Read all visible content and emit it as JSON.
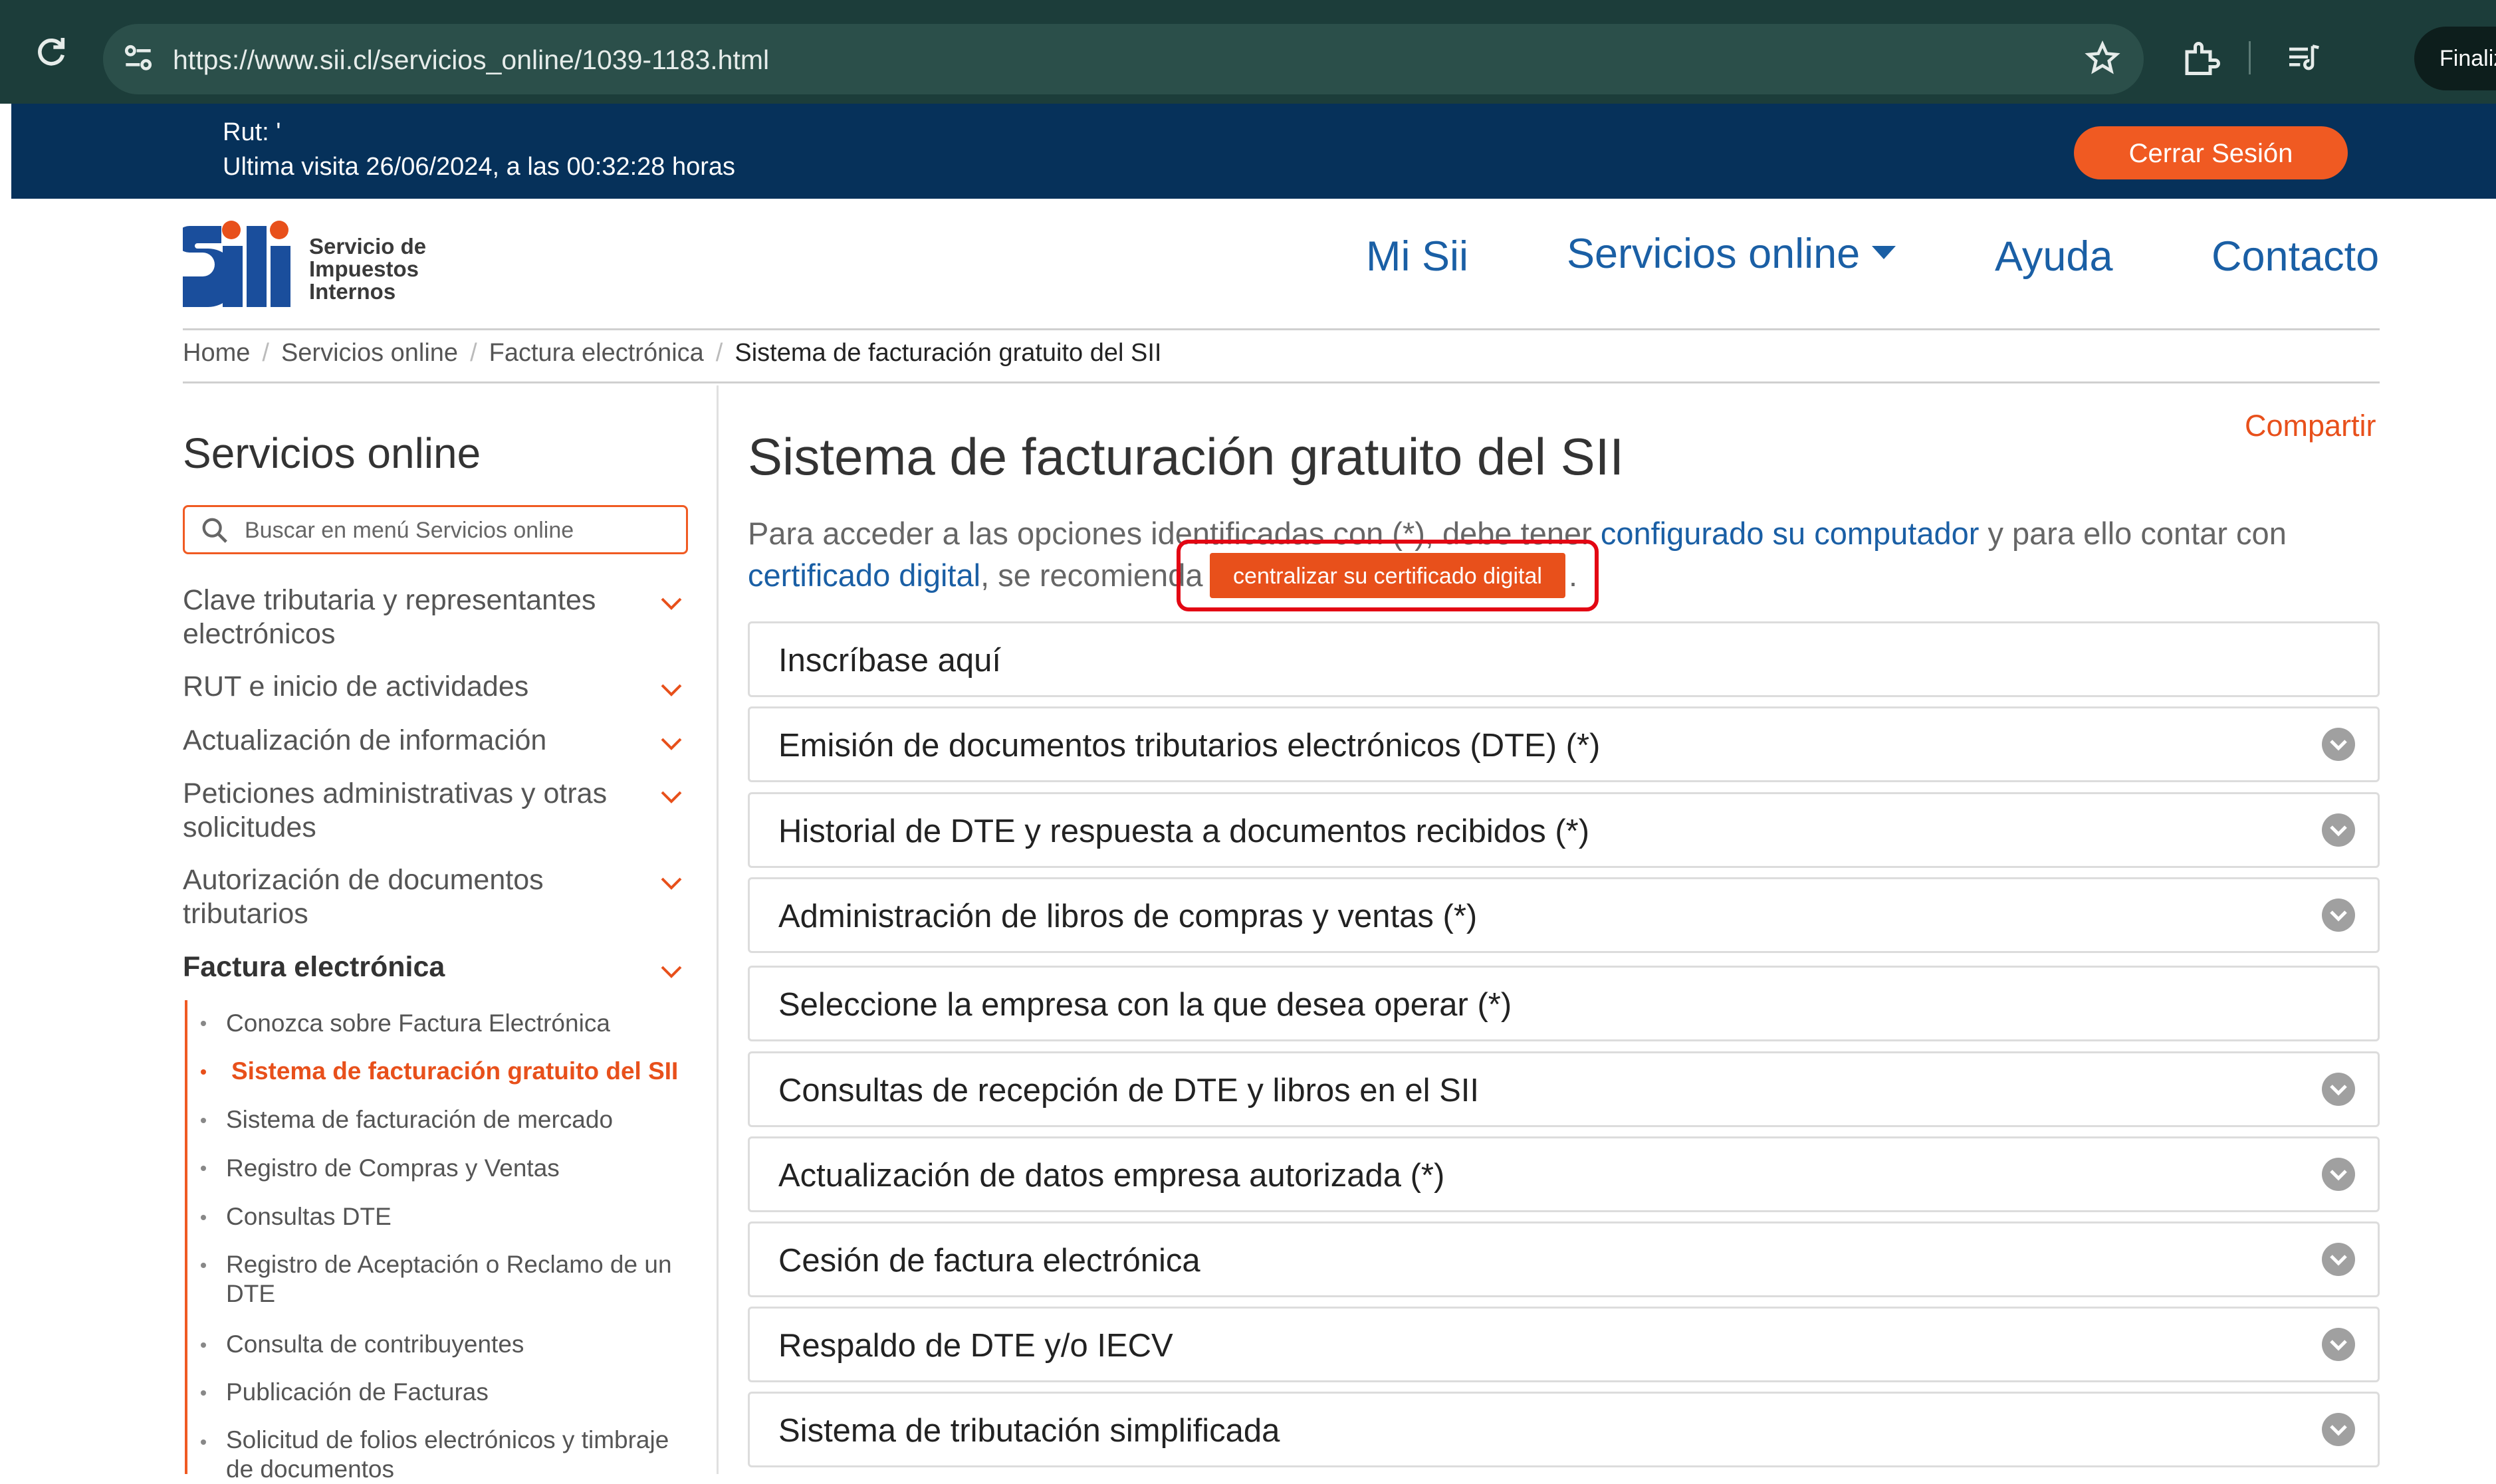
{
  "browser": {
    "url": "https://www.sii.cl/servicios_online/1039-1183.html",
    "profile_label": "Finaliz"
  },
  "session": {
    "rut_label": "Rut: '",
    "last_visit": "Ultima visita 26/06/2024, a las 00:32:28 horas",
    "logout_label": "Cerrar Sesión"
  },
  "logo": {
    "line1": "Servicio de",
    "line2": "Impuestos",
    "line3": "Internos"
  },
  "nav": {
    "items": [
      "Mi Sii",
      "Servicios online",
      "Ayuda",
      "Contacto"
    ]
  },
  "breadcrumb": [
    "Home",
    "Servicios online",
    "Factura electrónica",
    "Sistema de facturación gratuito del SII"
  ],
  "sidebar": {
    "title": "Servicios online",
    "search_placeholder": "Buscar en menú Servicios online",
    "categories": [
      "Clave tributaria y representantes electrónicos",
      "RUT e inicio de actividades",
      "Actualización de información",
      "Peticiones administrativas y otras solicitudes",
      "Autorización de documentos tributarios",
      "Factura electrónica"
    ],
    "subitems": [
      "Conozca sobre Factura Electrónica",
      "Sistema de facturación gratuito del SII",
      "Sistema de facturación de mercado",
      "Registro de Compras y Ventas",
      "Consultas DTE",
      "Registro de Aceptación o Reclamo de un DTE",
      "Consulta de contribuyentes",
      "Publicación de Facturas",
      "Solicitud de folios electrónicos y timbraje de documentos"
    ]
  },
  "main": {
    "share": "Compartir",
    "title": "Sistema de facturación gratuito del SII",
    "intro": {
      "p1": "Para acceder a las opciones identificadas con (*), debe tener ",
      "link1": "configurado su computador",
      "p2": " y para ello contar con",
      "link2": "certificado digital",
      "p3": ", se recomienda ",
      "button": "centralizar su certificado digital",
      "end": "."
    },
    "accordion": [
      "Inscríbase aquí",
      "Emisión de documentos tributarios electrónicos (DTE) (*)",
      "Historial de DTE y respuesta a documentos recibidos (*)",
      "Administración de libros de compras y ventas (*)",
      "Seleccione la empresa con la que desea operar (*)",
      "Consultas de recepción de DTE y libros en el SII",
      "Actualización de datos empresa autorizada (*)",
      "Cesión de factura electrónica",
      "Respaldo de DTE y/o IECV",
      "Sistema de tributación simplificada"
    ]
  },
  "colors": {
    "accent": "#f05a22",
    "session_bar": "#06315a",
    "link": "#1a5fa5",
    "highlight": "#e30613"
  }
}
